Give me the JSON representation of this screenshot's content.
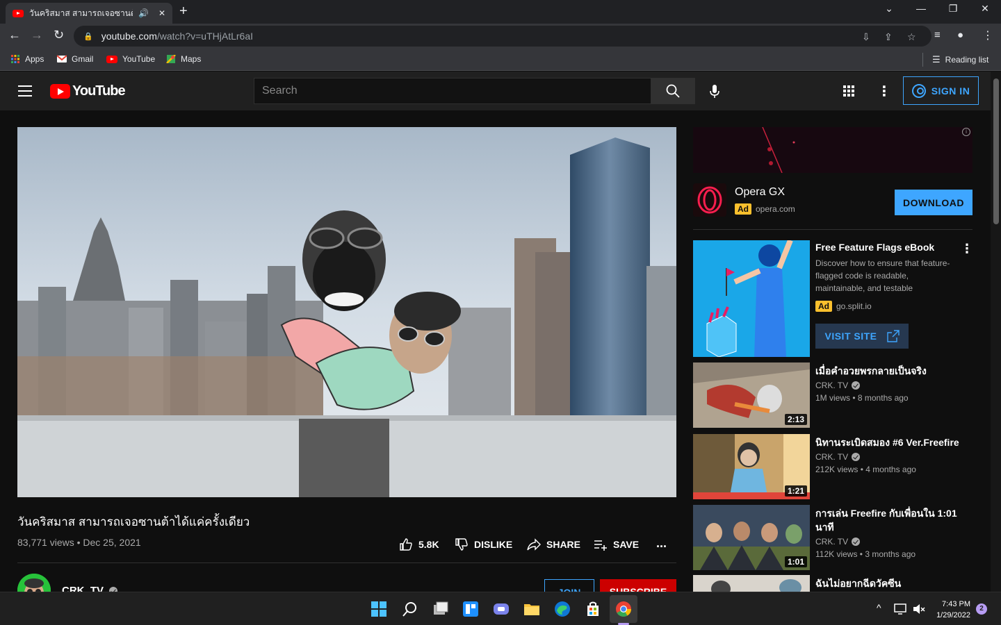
{
  "browser": {
    "tab_title": "วันคริสมาส สามารถเจอซานต้าได้",
    "url_host": "youtube.com",
    "url_path": "/watch?v=uTHjAtLr6aI",
    "bookmarks": [
      "Apps",
      "Gmail",
      "YouTube",
      "Maps"
    ],
    "reading_list": "Reading list"
  },
  "header": {
    "logo_text": "YouTube",
    "search_placeholder": "Search",
    "sign_in_label": "SIGN IN"
  },
  "video": {
    "title": "วันคริสมาส สามารถเจอซานต้าได้แค่ครั้งเดียว",
    "meta": "83,771 views • Dec 25, 2021",
    "like_count": "5.8K",
    "dislike_label": "DISLIKE",
    "share_label": "SHARE",
    "save_label": "SAVE",
    "more_label": "...",
    "channel_name": "CRK. TV",
    "join_label": "JOIN",
    "subscribe_label": "SUBSCRIBE"
  },
  "ad_opera": {
    "title": "Opera GX",
    "badge": "Ad",
    "domain": "opera.com",
    "button": "DOWNLOAD"
  },
  "ad_feature": {
    "title": "Free Feature Flags eBook",
    "description": "Discover how to ensure that feature-flagged code is readable, maintainable, and testable",
    "badge": "Ad",
    "domain": "go.split.io",
    "button": "VISIT SITE"
  },
  "recommendations": [
    {
      "title": "เมื่อคำอวยพรกลายเป็นจริง",
      "channel": "CRK. TV",
      "meta": "1M views • 8 months ago",
      "duration": "2:13"
    },
    {
      "title": "นิทานระเบิดสมอง #6 Ver.Freefire",
      "channel": "CRK. TV",
      "meta": "212K views • 4 months ago",
      "duration": "1:21"
    },
    {
      "title": "การเล่น Freefire กับเพื่อนใน 1:01 นาที",
      "channel": "CRK. TV",
      "meta": "112K views • 3 months ago",
      "duration": "1:01"
    },
    {
      "title": "ฉันไม่อยากฉีดวัคซีน",
      "channel": "",
      "meta": "",
      "duration": ""
    }
  ],
  "taskbar": {
    "time": "7:43 PM",
    "date": "1/29/2022",
    "notifications": "2"
  },
  "colors": {
    "accent_blue": "#3ea6ff",
    "youtube_red": "#ff0000",
    "subscribe_red": "#cc0000",
    "ad_yellow": "#fbc02d"
  }
}
